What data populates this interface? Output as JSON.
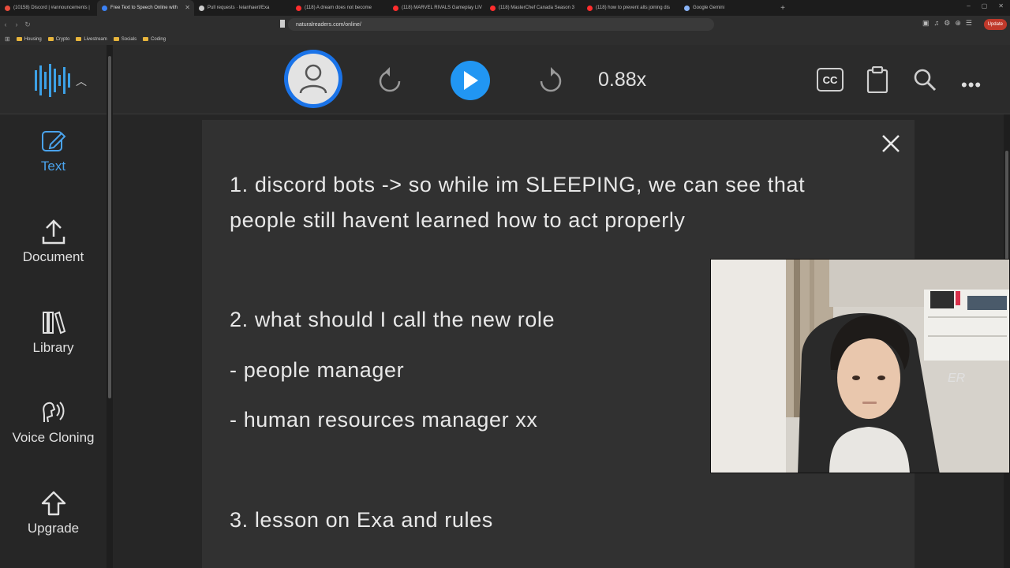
{
  "browser": {
    "tabs": [
      {
        "title": "(10158) Discord | #announcements |",
        "color": "#e74c3c",
        "active": false
      },
      {
        "title": "Free Text to Speech Online with",
        "color": "#3b82f6",
        "active": true
      },
      {
        "title": "Pull requests · leianhaert/Exa",
        "color": "#cccccc",
        "active": false
      },
      {
        "title": "(118) A dream does not become",
        "color": "#ff2d2d",
        "active": false
      },
      {
        "title": "(118) MARVEL RIVALS Gameplay LIV",
        "color": "#ff2d2d",
        "active": false
      },
      {
        "title": "(118) MasterChef Canada Season 3",
        "color": "#ff2d2d",
        "active": false
      },
      {
        "title": "(118) how to prevent alts joining dis",
        "color": "#ff2d2d",
        "active": false
      },
      {
        "title": "Google Gemini",
        "color": "#8ab4f8",
        "active": false
      }
    ],
    "url": "naturalreaders.com/online/",
    "update_label": "Update",
    "bookmarks": [
      "Housing",
      "Crypto",
      "Livestream",
      "Socials",
      "Coding"
    ]
  },
  "header": {
    "speed": "0.88x",
    "cc_label": "CC"
  },
  "sidebar": {
    "items": [
      {
        "label": "Text",
        "icon": "edit-icon",
        "active": true
      },
      {
        "label": "Document",
        "icon": "upload-icon",
        "active": false
      },
      {
        "label": "Library",
        "icon": "library-icon",
        "active": false
      },
      {
        "label": "Voice Cloning",
        "icon": "voice-clone-icon",
        "active": false
      },
      {
        "label": "Upgrade",
        "icon": "upgrade-arrow-icon",
        "active": false
      }
    ]
  },
  "document": {
    "lines": [
      "1. discord bots -> so while im SLEEPING, we can see that",
      "people still havent learned how to act properly",
      "2. what should I call the new role",
      "- people manager",
      "- human resources manager xx",
      "3. lesson on Exa and rules"
    ]
  },
  "colors": {
    "accent": "#2196f3",
    "active_text": "#4aa3ec",
    "background": "#2b2b2b",
    "card": "#313131"
  }
}
